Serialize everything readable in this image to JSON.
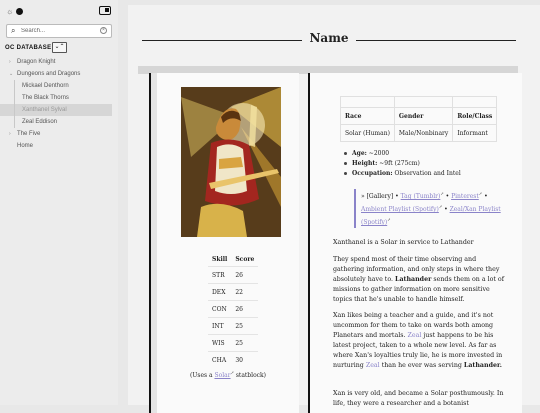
{
  "sidebar": {
    "search_placeholder": "Search...",
    "database_title": "OC DATABASE",
    "nav": [
      {
        "label": "Dragon Knight",
        "level": 1,
        "chevron": "›"
      },
      {
        "label": "Dungeons and Dragons",
        "level": 1,
        "chevron": "⌄"
      },
      {
        "label": "Mickael Denthorn",
        "level": 2
      },
      {
        "label": "The Black Thorns",
        "level": 2
      },
      {
        "label": "Xanthanel Sylval",
        "level": 2,
        "active": true
      },
      {
        "label": "Zeal Eddison",
        "level": 2
      },
      {
        "label": "The Five",
        "level": 1,
        "chevron": "›"
      },
      {
        "label": "Home",
        "level": 0
      }
    ]
  },
  "page": {
    "title": "Name"
  },
  "stats": {
    "headers": [
      "Skill",
      "Score"
    ],
    "rows": [
      [
        "STR",
        "26"
      ],
      [
        "DEX",
        "22"
      ],
      [
        "CON",
        "26"
      ],
      [
        "INT",
        "25"
      ],
      [
        "WIS",
        "25"
      ],
      [
        "CHA",
        "30"
      ]
    ],
    "uses_prefix": "(Uses a ",
    "uses_link": "Solar",
    "uses_suffix": " statblock)"
  },
  "info": {
    "headers": [
      "Race",
      "Gender",
      "Role/Class"
    ],
    "values": [
      "Solar (Human)",
      "Male/Nonbinary",
      "Informant"
    ]
  },
  "facts": [
    {
      "label": "Age:",
      "value": " ~2000"
    },
    {
      "label": "Height:",
      "value": " ~9ft (275cm)"
    },
    {
      "label": "Occupation:",
      "value": " Observation and Intel"
    }
  ],
  "gallery": {
    "prefix": "» [Gallery] • ",
    "links": [
      "Tag (Tumblr)",
      "Pinterest",
      "Ambient Playlist (Spotify)",
      "Zeal/Xan Playlist (Spotify)"
    ],
    "sep": " • "
  },
  "paragraphs": {
    "p1": "Xanthanel is a Solar in service to Lathander",
    "p2a": "They spend most of their time observing and gathering information, and only steps in where they absolutely have to. ",
    "p2b": "Lathander",
    "p2c": " sends them on a lot of missions to gather information on more sensitive topics that he's unable to handle himself.",
    "p3a": "Xan likes being a teacher and a guide, and it's not uncommon for them to take on wards both among Planetars and mortals. ",
    "p3b": "Zeal",
    "p3c": " just happens to be his latest project, taken to a whole new level. As far as where Xan's loyalties truly lie, he is more invested in nurturing ",
    "p3d": "Zeal",
    "p3e": " than he ever was serving ",
    "p3f": "Lathander.",
    "p4": "Xan is very old, and became a Solar posthumously. In life, they were a researcher and a botanist"
  },
  "colors": {
    "link": "#8a83c9",
    "accent_border": "#111111"
  }
}
